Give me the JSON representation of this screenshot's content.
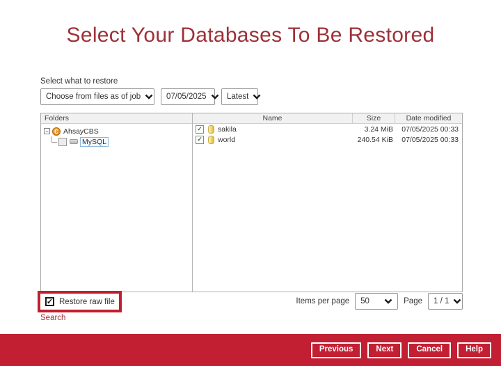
{
  "colors": {
    "accent_red": "#c21f33",
    "title_red": "#9e3039",
    "annotation_red": "#c11f2f",
    "selection_blue": "#8fb7dc"
  },
  "icons": {
    "minus": "−",
    "check": "✓",
    "cbs_letter": "C"
  },
  "page": {
    "title": "Select Your Databases To Be Restored"
  },
  "filters": {
    "label": "Select what to restore",
    "job_dropdown_value": "Choose from files as of job",
    "date_dropdown_value": "07/05/2025",
    "version_dropdown_value": "Latest"
  },
  "tree": {
    "header": "Folders",
    "root_label": "AhsayCBS",
    "child_label": "MySQL"
  },
  "files": {
    "columns": {
      "name": "Name",
      "size": "Size",
      "date": "Date modified"
    },
    "rows": [
      {
        "name": "sakila",
        "size": "3.24 MiB",
        "date": "07/05/2025 00:33"
      },
      {
        "name": "world",
        "size": "240.54 KiB",
        "date": "07/05/2025 00:33"
      }
    ]
  },
  "controls": {
    "restore_raw_label": "Restore raw file",
    "search_label": "Search",
    "items_per_page_label": "Items per page",
    "items_per_page_value": "50",
    "page_label": "Page",
    "page_value": "1 / 1"
  },
  "footer": {
    "buttons": [
      {
        "label": "Previous"
      },
      {
        "label": "Next"
      },
      {
        "label": "Cancel"
      },
      {
        "label": "Help"
      }
    ]
  }
}
